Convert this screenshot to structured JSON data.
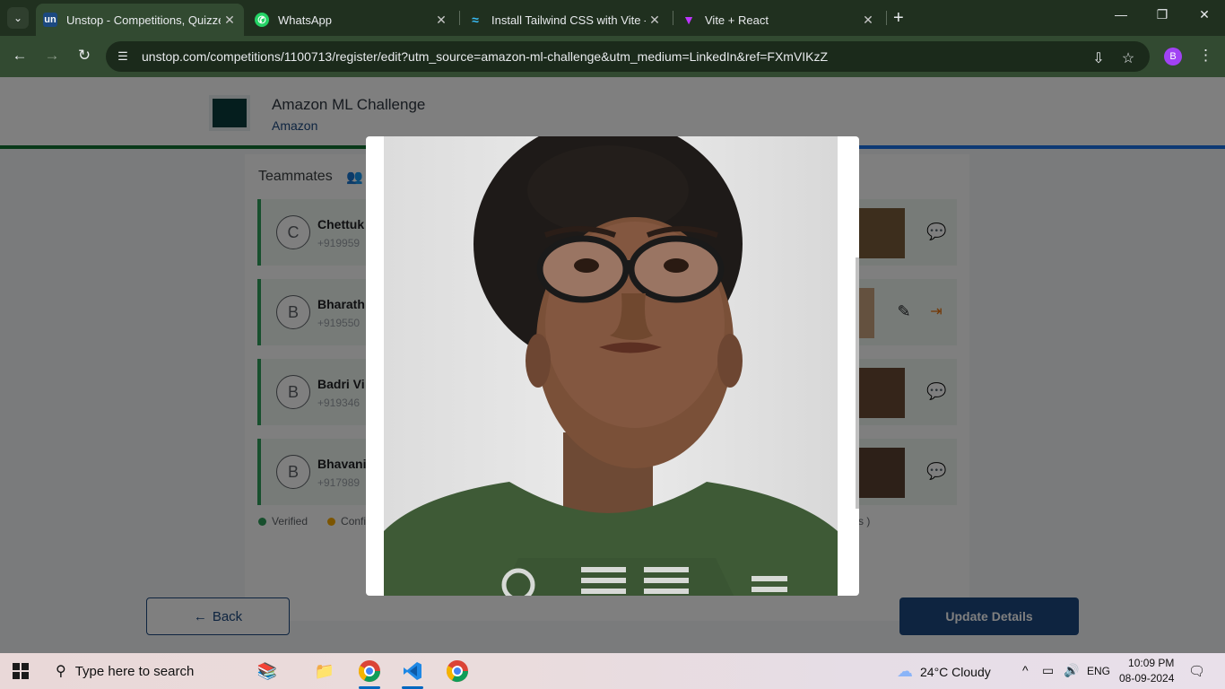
{
  "browser": {
    "tabs": [
      {
        "title": "Unstop - Competitions, Quizzes",
        "favicon": "un",
        "active": true
      },
      {
        "title": "WhatsApp",
        "favicon": "whatsapp-icon",
        "active": false
      },
      {
        "title": "Install Tailwind CSS with Vite - T",
        "favicon": "tailwind-icon",
        "active": false
      },
      {
        "title": "Vite + React",
        "favicon": "vite-icon",
        "active": false
      }
    ],
    "url": "unstop.com/competitions/1100713/register/edit?utm_source=amazon-ml-challenge&utm_medium=LinkedIn&ref=FXmVIKzZ",
    "profile_initial": "B"
  },
  "competition": {
    "title": "Amazon ML Challenge",
    "organizer": "Amazon",
    "progress_percent": 57
  },
  "teammates": {
    "heading": "Teammates",
    "members": [
      {
        "initial": "C",
        "name": "Chettuk",
        "phone": "+919959"
      },
      {
        "initial": "B",
        "name": "Bharath",
        "phone": "+919550"
      },
      {
        "initial": "B",
        "name": "Badri Vi",
        "phone": "+919346"
      },
      {
        "initial": "B",
        "name": "Bhavani",
        "phone": "+917989"
      }
    ],
    "legend": {
      "verified": "Verified",
      "confirmed": "Confir",
      "tail": "s )"
    }
  },
  "buttons": {
    "back": "Back",
    "update": "Update Details"
  },
  "colors": {
    "brand_blue": "#1c4980",
    "verified_green": "#2e9e5b",
    "confirm_yellow": "#f9ab00"
  },
  "taskbar": {
    "search_placeholder": "Type here to search",
    "weather": "24°C  Cloudy",
    "language": "ENG",
    "time": "10:09 PM",
    "date": "08-09-2024"
  }
}
